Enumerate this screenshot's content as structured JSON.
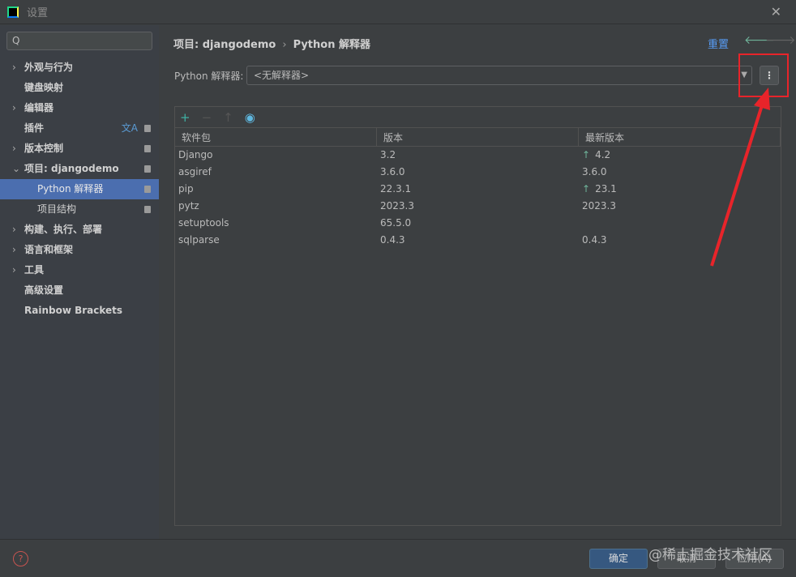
{
  "window": {
    "title": "设置",
    "close": "✕"
  },
  "sidebar": {
    "search_placeholder": "Q",
    "items": [
      {
        "label": "外观与行为",
        "chevron": "›"
      },
      {
        "label": "键盘映射"
      },
      {
        "label": "编辑器",
        "chevron": "›"
      },
      {
        "label": "插件",
        "translate": "文A"
      },
      {
        "label": "版本控制",
        "chevron": "›"
      },
      {
        "label": "项目: djangodemo",
        "chevron": "⌄"
      },
      {
        "label": "Python 解释器"
      },
      {
        "label": "项目结构"
      },
      {
        "label": "构建、执行、部署",
        "chevron": "›"
      },
      {
        "label": "语言和框架",
        "chevron": "›"
      },
      {
        "label": "工具",
        "chevron": "›"
      },
      {
        "label": "高级设置"
      },
      {
        "label": "Rainbow Brackets"
      }
    ]
  },
  "main": {
    "breadcrumb": [
      "项目: djangodemo",
      "Python 解释器"
    ],
    "breadcrumb_sep": "›",
    "reset": "重置",
    "interpreter_label": "Python 解释器:",
    "interpreter_value": "<无解释器>",
    "columns": [
      "软件包",
      "版本",
      "最新版本"
    ],
    "packages": [
      {
        "name": "Django",
        "version": "3.2",
        "latest": "4.2",
        "upgrade": true
      },
      {
        "name": "asgiref",
        "version": "3.6.0",
        "latest": "3.6.0",
        "upgrade": false
      },
      {
        "name": "pip",
        "version": "22.3.1",
        "latest": "23.1",
        "upgrade": true
      },
      {
        "name": "pytz",
        "version": "2023.3",
        "latest": "2023.3",
        "upgrade": false
      },
      {
        "name": "setuptools",
        "version": "65.5.0",
        "latest": "",
        "upgrade": false
      },
      {
        "name": "sqlparse",
        "version": "0.4.3",
        "latest": "0.4.3",
        "upgrade": false
      }
    ]
  },
  "footer": {
    "ok": "确定",
    "cancel": "取消",
    "apply": "应用(A)",
    "help": "?"
  },
  "watermark": "@稀土掘金技术社区",
  "colors": {
    "selection": "#4b6eaf",
    "link": "#589df6",
    "upgrade": "#6fb39a",
    "annotation": "#e8242a"
  }
}
